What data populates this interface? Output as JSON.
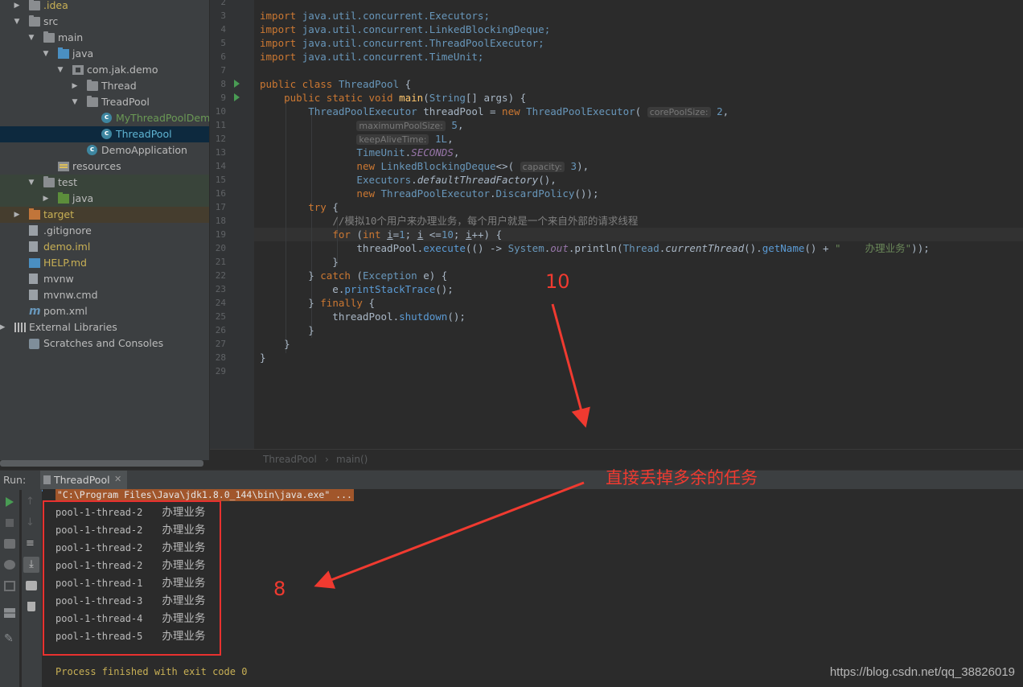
{
  "tree": {
    "items": [
      {
        "label": ".idea",
        "expanded": false,
        "icon": "folder-icon",
        "color": "orange"
      },
      {
        "label": "src",
        "expanded": true,
        "icon": "folder-icon"
      },
      {
        "label": "main",
        "expanded": true,
        "icon": "folder-icon"
      },
      {
        "label": "java",
        "expanded": true,
        "icon": "source-folder-icon"
      },
      {
        "label": "com.jak.demo",
        "expanded": true,
        "icon": "package-icon"
      },
      {
        "label": "Thread",
        "expanded": false,
        "icon": "folder-icon"
      },
      {
        "label": "TreadPool",
        "expanded": true,
        "icon": "folder-icon"
      },
      {
        "label": "MyThreadPoolDemo",
        "icon": "class-icon",
        "color": "green"
      },
      {
        "label": "ThreadPool",
        "icon": "class-icon",
        "selected": true
      },
      {
        "label": "DemoApplication",
        "icon": "class-icon"
      },
      {
        "label": "resources",
        "icon": "resources-folder-icon"
      },
      {
        "label": "test",
        "expanded": true,
        "icon": "folder-icon"
      },
      {
        "label": "java",
        "expanded": false,
        "icon": "test-folder-icon"
      },
      {
        "label": "target",
        "expanded": false,
        "icon": "excluded-folder-icon",
        "color": "orange"
      },
      {
        "label": ".gitignore",
        "icon": "file-icon"
      },
      {
        "label": "demo.iml",
        "icon": "iml-file-icon",
        "color": "orange"
      },
      {
        "label": "HELP.md",
        "icon": "markdown-icon",
        "color": "orange"
      },
      {
        "label": "mvnw",
        "icon": "file-icon"
      },
      {
        "label": "mvnw.cmd",
        "icon": "file-icon"
      },
      {
        "label": "pom.xml",
        "icon": "maven-icon"
      },
      {
        "label": "External Libraries",
        "expanded": false,
        "icon": "library-icon"
      },
      {
        "label": "Scratches and Consoles",
        "icon": "scratches-icon"
      }
    ]
  },
  "editor": {
    "line_numbers": [
      "2",
      "3",
      "4",
      "5",
      "6",
      "7",
      "8",
      "9",
      "10",
      "11",
      "12",
      "13",
      "14",
      "15",
      "16",
      "17",
      "18",
      "19",
      "20",
      "21",
      "22",
      "23",
      "24",
      "25",
      "26",
      "27",
      "28",
      "29"
    ],
    "imports": [
      "java.util.concurrent.Executors;",
      "java.util.concurrent.LinkedBlockingDeque;",
      "java.util.concurrent.ThreadPoolExecutor;",
      "java.util.concurrent.TimeUnit;"
    ],
    "hints": {
      "core": "corePoolSize:",
      "max": "maximumPoolSize:",
      "keep": "keepAliveTime:",
      "cap": "capacity:"
    },
    "comment": "//模拟10个用户来办理业务，每个用户就是一个来自外部的请求线程",
    "string_literal": "\"    办理业务\"",
    "breadcrumb": [
      "ThreadPool",
      "main()"
    ]
  },
  "run": {
    "label": "Run:",
    "tab": "ThreadPool",
    "command": "\"C:\\Program Files\\Java\\jdk1.8.0_144\\bin\\java.exe\" ...",
    "output": [
      {
        "thread": "pool-1-thread-2",
        "msg": "办理业务"
      },
      {
        "thread": "pool-1-thread-2",
        "msg": "办理业务"
      },
      {
        "thread": "pool-1-thread-2",
        "msg": "办理业务"
      },
      {
        "thread": "pool-1-thread-2",
        "msg": "办理业务"
      },
      {
        "thread": "pool-1-thread-1",
        "msg": "办理业务"
      },
      {
        "thread": "pool-1-thread-3",
        "msg": "办理业务"
      },
      {
        "thread": "pool-1-thread-4",
        "msg": "办理业务"
      },
      {
        "thread": "pool-1-thread-5",
        "msg": "办理业务"
      }
    ],
    "exit": "Process finished with exit code 0"
  },
  "annotations": {
    "ten": "10",
    "eight": "8",
    "note": "直接丢掉多余的任务",
    "color": "#f03a30"
  },
  "watermark": "https://blog.csdn.net/qq_38826019"
}
